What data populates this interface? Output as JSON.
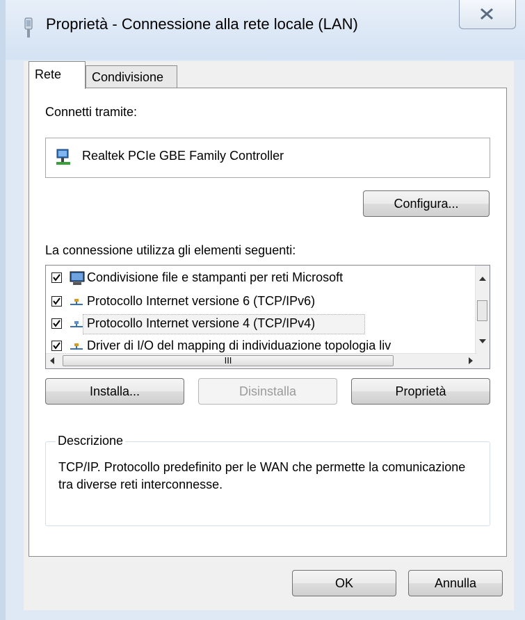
{
  "window": {
    "title": "Proprietà - Connessione alla rete locale (LAN)"
  },
  "tabs": [
    {
      "label": "Rete",
      "selected": true
    },
    {
      "label": "Condivisione",
      "selected": false
    }
  ],
  "connect_via": {
    "label": "Connetti tramite:",
    "adapter_name": "Realtek PCIe GBE Family Controller",
    "configure_button": "Configura..."
  },
  "components": {
    "label": "La connessione utilizza gli elementi seguenti:",
    "items": [
      {
        "label": "Condivisione file e stampanti per reti Microsoft",
        "checked": true,
        "icon": "computer-icon"
      },
      {
        "label": "Protocollo Internet versione 6 (TCP/IPv6)",
        "checked": true,
        "icon": "network-protocol-icon"
      },
      {
        "label": "Protocollo Internet versione 4 (TCP/IPv4)",
        "checked": true,
        "icon": "network-protocol-icon",
        "selected": true
      },
      {
        "label": "Driver di I/O del mapping di individuazione topologia liv",
        "checked": true,
        "icon": "network-protocol-icon"
      }
    ],
    "hscroll_thumb_glyph": "III"
  },
  "buttons": {
    "install": "Installa...",
    "uninstall": "Disinstalla",
    "properties": "Proprietà",
    "ok": "OK",
    "cancel": "Annulla"
  },
  "description": {
    "title": "Descrizione",
    "text": "TCP/IP. Protocollo predefinito per le WAN che permette la comunicazione tra diverse reti interconnesse."
  },
  "colors": {
    "frame": "#dfe9f5",
    "dialog_bg": "#f0f0f0",
    "disabled_text": "#9a9a9a"
  }
}
